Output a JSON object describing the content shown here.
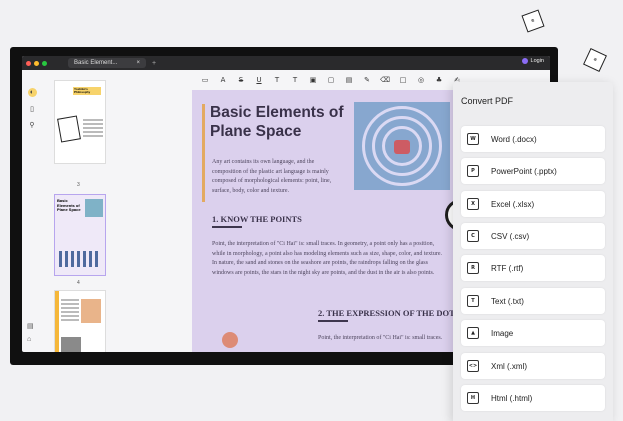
{
  "window": {
    "tab_title": "Basic Element...",
    "login_label": "Login"
  },
  "pages": [
    {
      "number": "3"
    },
    {
      "number": "4"
    }
  ],
  "thumb_titles": {
    "p3": "Yoshiko's Philosophy",
    "p4": "Basic Elements of Plane Space"
  },
  "document": {
    "title": "Basic Elements of Plane Space",
    "intro": "Any art contains its own language, and the composition of the plastic art language is mainly composed of morphological elements: point, line, surface, body, color and texture.",
    "section1_heading": "1. KNOW THE POINTS",
    "section1_body": "Point, the interpretation of \"Ci Hai\" is: small traces. In geometry, a point only has a position, while in morphology, a point also has modeling elements such as size, shape, color, and texture. In nature, the sand and stones on the seashore are points, the raindrops falling on the glass windows are points, the stars in the night sky are points, and the dust in the air is also points.",
    "section2_heading": "2. THE EXPRESSION OF THE DOT",
    "section2_body": "Point, the interpretation of \"Ci Hai\" is: small traces."
  },
  "convert_panel": {
    "title": "Convert PDF",
    "options": [
      {
        "label": "Word (.docx)",
        "icon": "word-icon"
      },
      {
        "label": "PowerPoint (.pptx)",
        "icon": "powerpoint-icon"
      },
      {
        "label": "Excel (.xlsx)",
        "icon": "excel-icon"
      },
      {
        "label": "CSV (.csv)",
        "icon": "csv-icon"
      },
      {
        "label": "RTF (.rtf)",
        "icon": "rtf-icon"
      },
      {
        "label": "Text (.txt)",
        "icon": "text-icon"
      },
      {
        "label": "Image",
        "icon": "image-icon"
      },
      {
        "label": "Xml (.xml)",
        "icon": "xml-icon"
      },
      {
        "label": "Html (.html)",
        "icon": "html-icon"
      }
    ]
  },
  "colors": {
    "accent": "#9a82f0",
    "title_bar": "#2a2a2c",
    "highlight": "#f5b73a"
  }
}
